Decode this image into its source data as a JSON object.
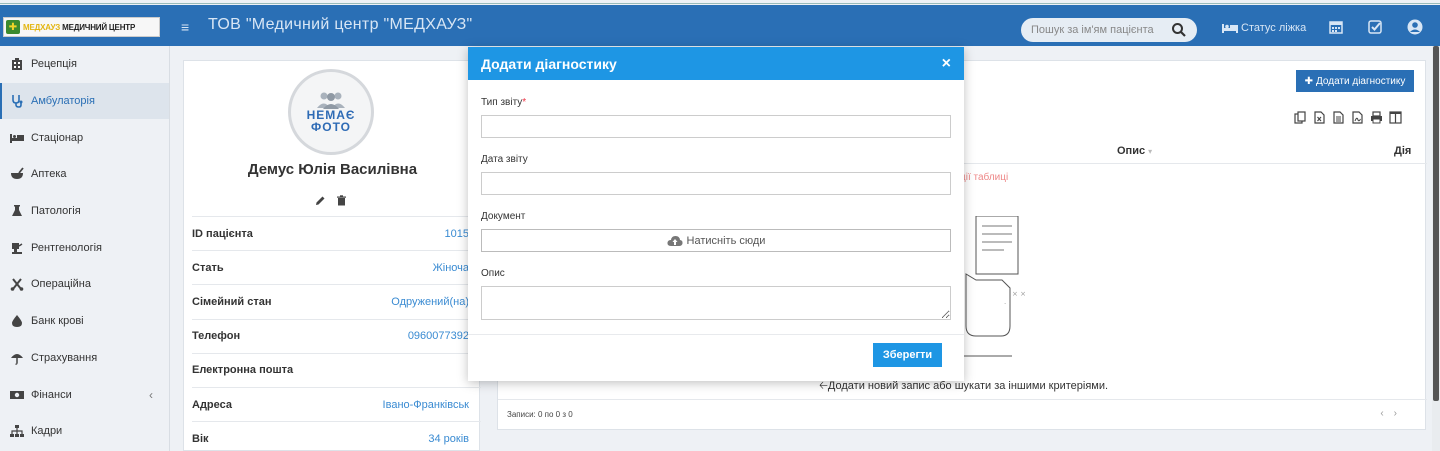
{
  "header": {
    "logo_prefix": "МЕДХАУЗ",
    "logo_text": "МЕДИЧНИЙ ЦЕНТР",
    "title": "ТОВ \"Медичний центр \"МЕДХАУЗ\"",
    "search_placeholder": "Пошук за ім'ям пацієнта",
    "bed_status": "Статус ліжка"
  },
  "sidebar": {
    "items": [
      {
        "label": "Рецепція",
        "icon": "building-icon"
      },
      {
        "label": "Амбулаторія",
        "icon": "stethoscope-icon"
      },
      {
        "label": "Стаціонар",
        "icon": "bed-icon"
      },
      {
        "label": "Аптека",
        "icon": "mortar-icon"
      },
      {
        "label": "Патологія",
        "icon": "flask-icon"
      },
      {
        "label": "Рентгенологія",
        "icon": "xray-icon"
      },
      {
        "label": "Операційна",
        "icon": "scissors-icon"
      },
      {
        "label": "Банк крові",
        "icon": "drop-icon"
      },
      {
        "label": "Страхування",
        "icon": "umbrella-icon"
      },
      {
        "label": "Фінанси",
        "icon": "money-icon"
      },
      {
        "label": "Кадри",
        "icon": "sitemap-icon"
      }
    ],
    "active_index": 1
  },
  "patient": {
    "no_photo_line1": "НЕМАЄ",
    "no_photo_line2": "ФОТО",
    "name": "Демус Юлія Василівна",
    "rows": [
      {
        "label": "ID пацієнта",
        "value": "1015"
      },
      {
        "label": "Стать",
        "value": "Жіноча"
      },
      {
        "label": "Сімейний стан",
        "value": "Одружений(на)"
      },
      {
        "label": "Телефон",
        "value": "0960077392"
      },
      {
        "label": "Електронна пошта",
        "value": ""
      },
      {
        "label": "Адреса",
        "value": "Івано-Франківськ"
      },
      {
        "label": "Вік",
        "value": "34 років"
      }
    ]
  },
  "main": {
    "add_button": "Додати діагностику",
    "col_desc": "Опис",
    "col_action": "Дія",
    "empty_red": "ції таблиці",
    "empty_hint": "Додати новий запис або шукати за іншими критеріями.",
    "records": "Записи: 0 по 0 з 0"
  },
  "modal": {
    "title": "Додати діагностику",
    "close": "×",
    "report_type_label": "Тип звіту",
    "required_mark": "*",
    "report_type_value": "",
    "report_date_label": "Дата звіту",
    "report_date_value": "",
    "document_label": "Документ",
    "upload_label": "Натисніть сюди",
    "description_label": "Опис",
    "description_value": "",
    "save": "Зберегти"
  },
  "colors": {
    "header": "#2a6fb5",
    "modal_header": "#1e96e4",
    "accent": "#3a8bd2"
  }
}
